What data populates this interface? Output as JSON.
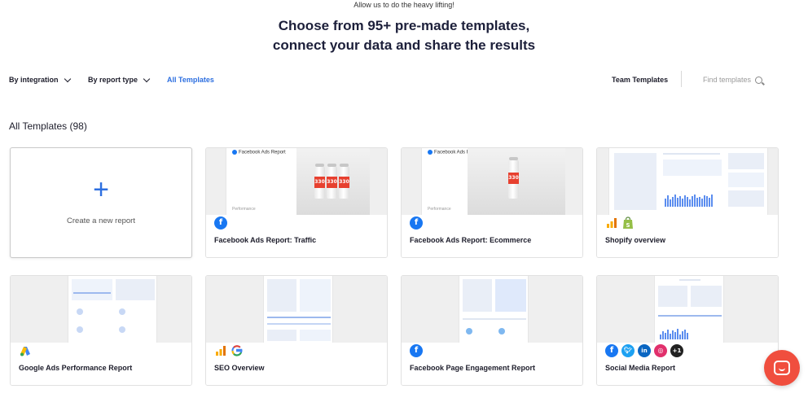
{
  "hero": {
    "subtitle": "Allow us to do the heavy lifting!",
    "title_line1": "Choose from 95+ pre-made templates,",
    "title_line2": "connect your data and share the results"
  },
  "filters": {
    "by_integration": "By integration",
    "by_report_type": "By report type",
    "all_templates": "All Templates",
    "team_templates": "Team Templates",
    "find_placeholder": "Find templates"
  },
  "section": {
    "title": "All Templates (98)"
  },
  "create_card": {
    "label": "Create a new report"
  },
  "cards": [
    {
      "title": "Facebook Ads Report: Traffic",
      "thumb_header": "Facebook Ads Report",
      "thumb_footer": "Performance",
      "can_label": "330",
      "icons": [
        "facebook-icon"
      ]
    },
    {
      "title": "Facebook Ads Report: Ecommerce",
      "thumb_header": "Facebook Ads Report",
      "thumb_footer": "Performance",
      "can_label": "330",
      "icons": [
        "facebook-icon"
      ]
    },
    {
      "title": "Shopify overview",
      "icons": [
        "bar-chart-icon",
        "shopify-icon"
      ]
    },
    {
      "title": "Google Ads Performance Report",
      "icons": [
        "google-ads-icon"
      ]
    },
    {
      "title": "SEO Overview",
      "icons": [
        "bar-chart-icon",
        "google-icon"
      ]
    },
    {
      "title": "Facebook Page Engagement Report",
      "icons": [
        "facebook-icon"
      ]
    },
    {
      "title": "Social Media Report",
      "icons": [
        "facebook-icon",
        "twitter-icon",
        "linkedin-icon",
        "instagram-icon",
        "more-badge"
      ],
      "more_count": "+1"
    }
  ],
  "colors": {
    "accent": "#2d6fe0",
    "facebook": "#1877f2",
    "launcher": "#f04e3e"
  }
}
